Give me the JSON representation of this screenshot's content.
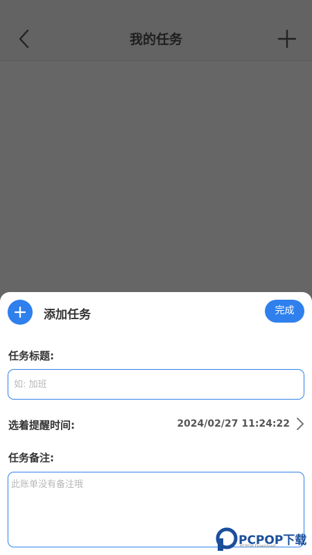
{
  "header": {
    "title": "我的任务",
    "back_icon": "chevron-left-icon",
    "add_icon": "plus-icon"
  },
  "sheet": {
    "title": "添加任务",
    "done_label": "完成",
    "task_title_label": "任务标题:",
    "task_title_placeholder": "如: 加班",
    "reminder_label": "选着提醒时间:",
    "reminder_value": "2024/02/27 11:24:22",
    "note_label": "任务备注:",
    "note_placeholder": "此账单没有备注哦"
  },
  "watermark": {
    "text": "PCPOP下载",
    "sub": "PCPOP Download"
  },
  "colors": {
    "accent": "#2f80ed",
    "overlay": "#666666"
  }
}
